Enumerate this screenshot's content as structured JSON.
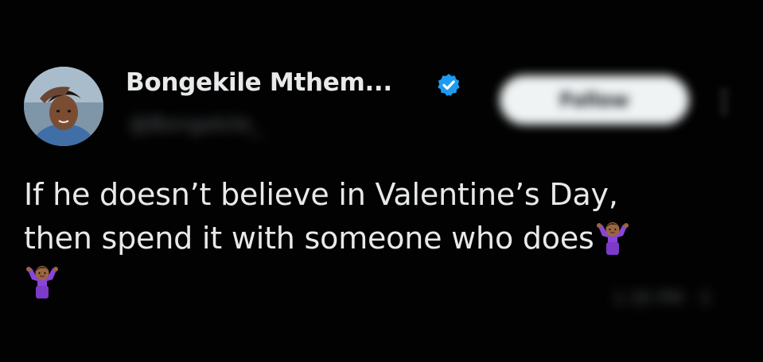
{
  "author": {
    "display_name": "Bongekile Mthem...",
    "handle": "@Bongekile_",
    "verified": true,
    "avatar_icon": "profile-photo"
  },
  "header": {
    "follow_label": "Follow",
    "more_icon": "more-vertical-icon"
  },
  "tweet": {
    "line1": "If he doesn’t believe in Valentine’s Day,",
    "line2": "then spend it with someone who does",
    "emoji_name": "person-shrugging-emoji"
  },
  "meta": {
    "timestamp": "1:30 PM · 2"
  },
  "colors": {
    "background": "#020202",
    "text_primary": "#e7e9ea",
    "text_secondary": "#71767b",
    "verified_blue": "#1d9bf0",
    "follow_bg": "#eff3f4"
  }
}
